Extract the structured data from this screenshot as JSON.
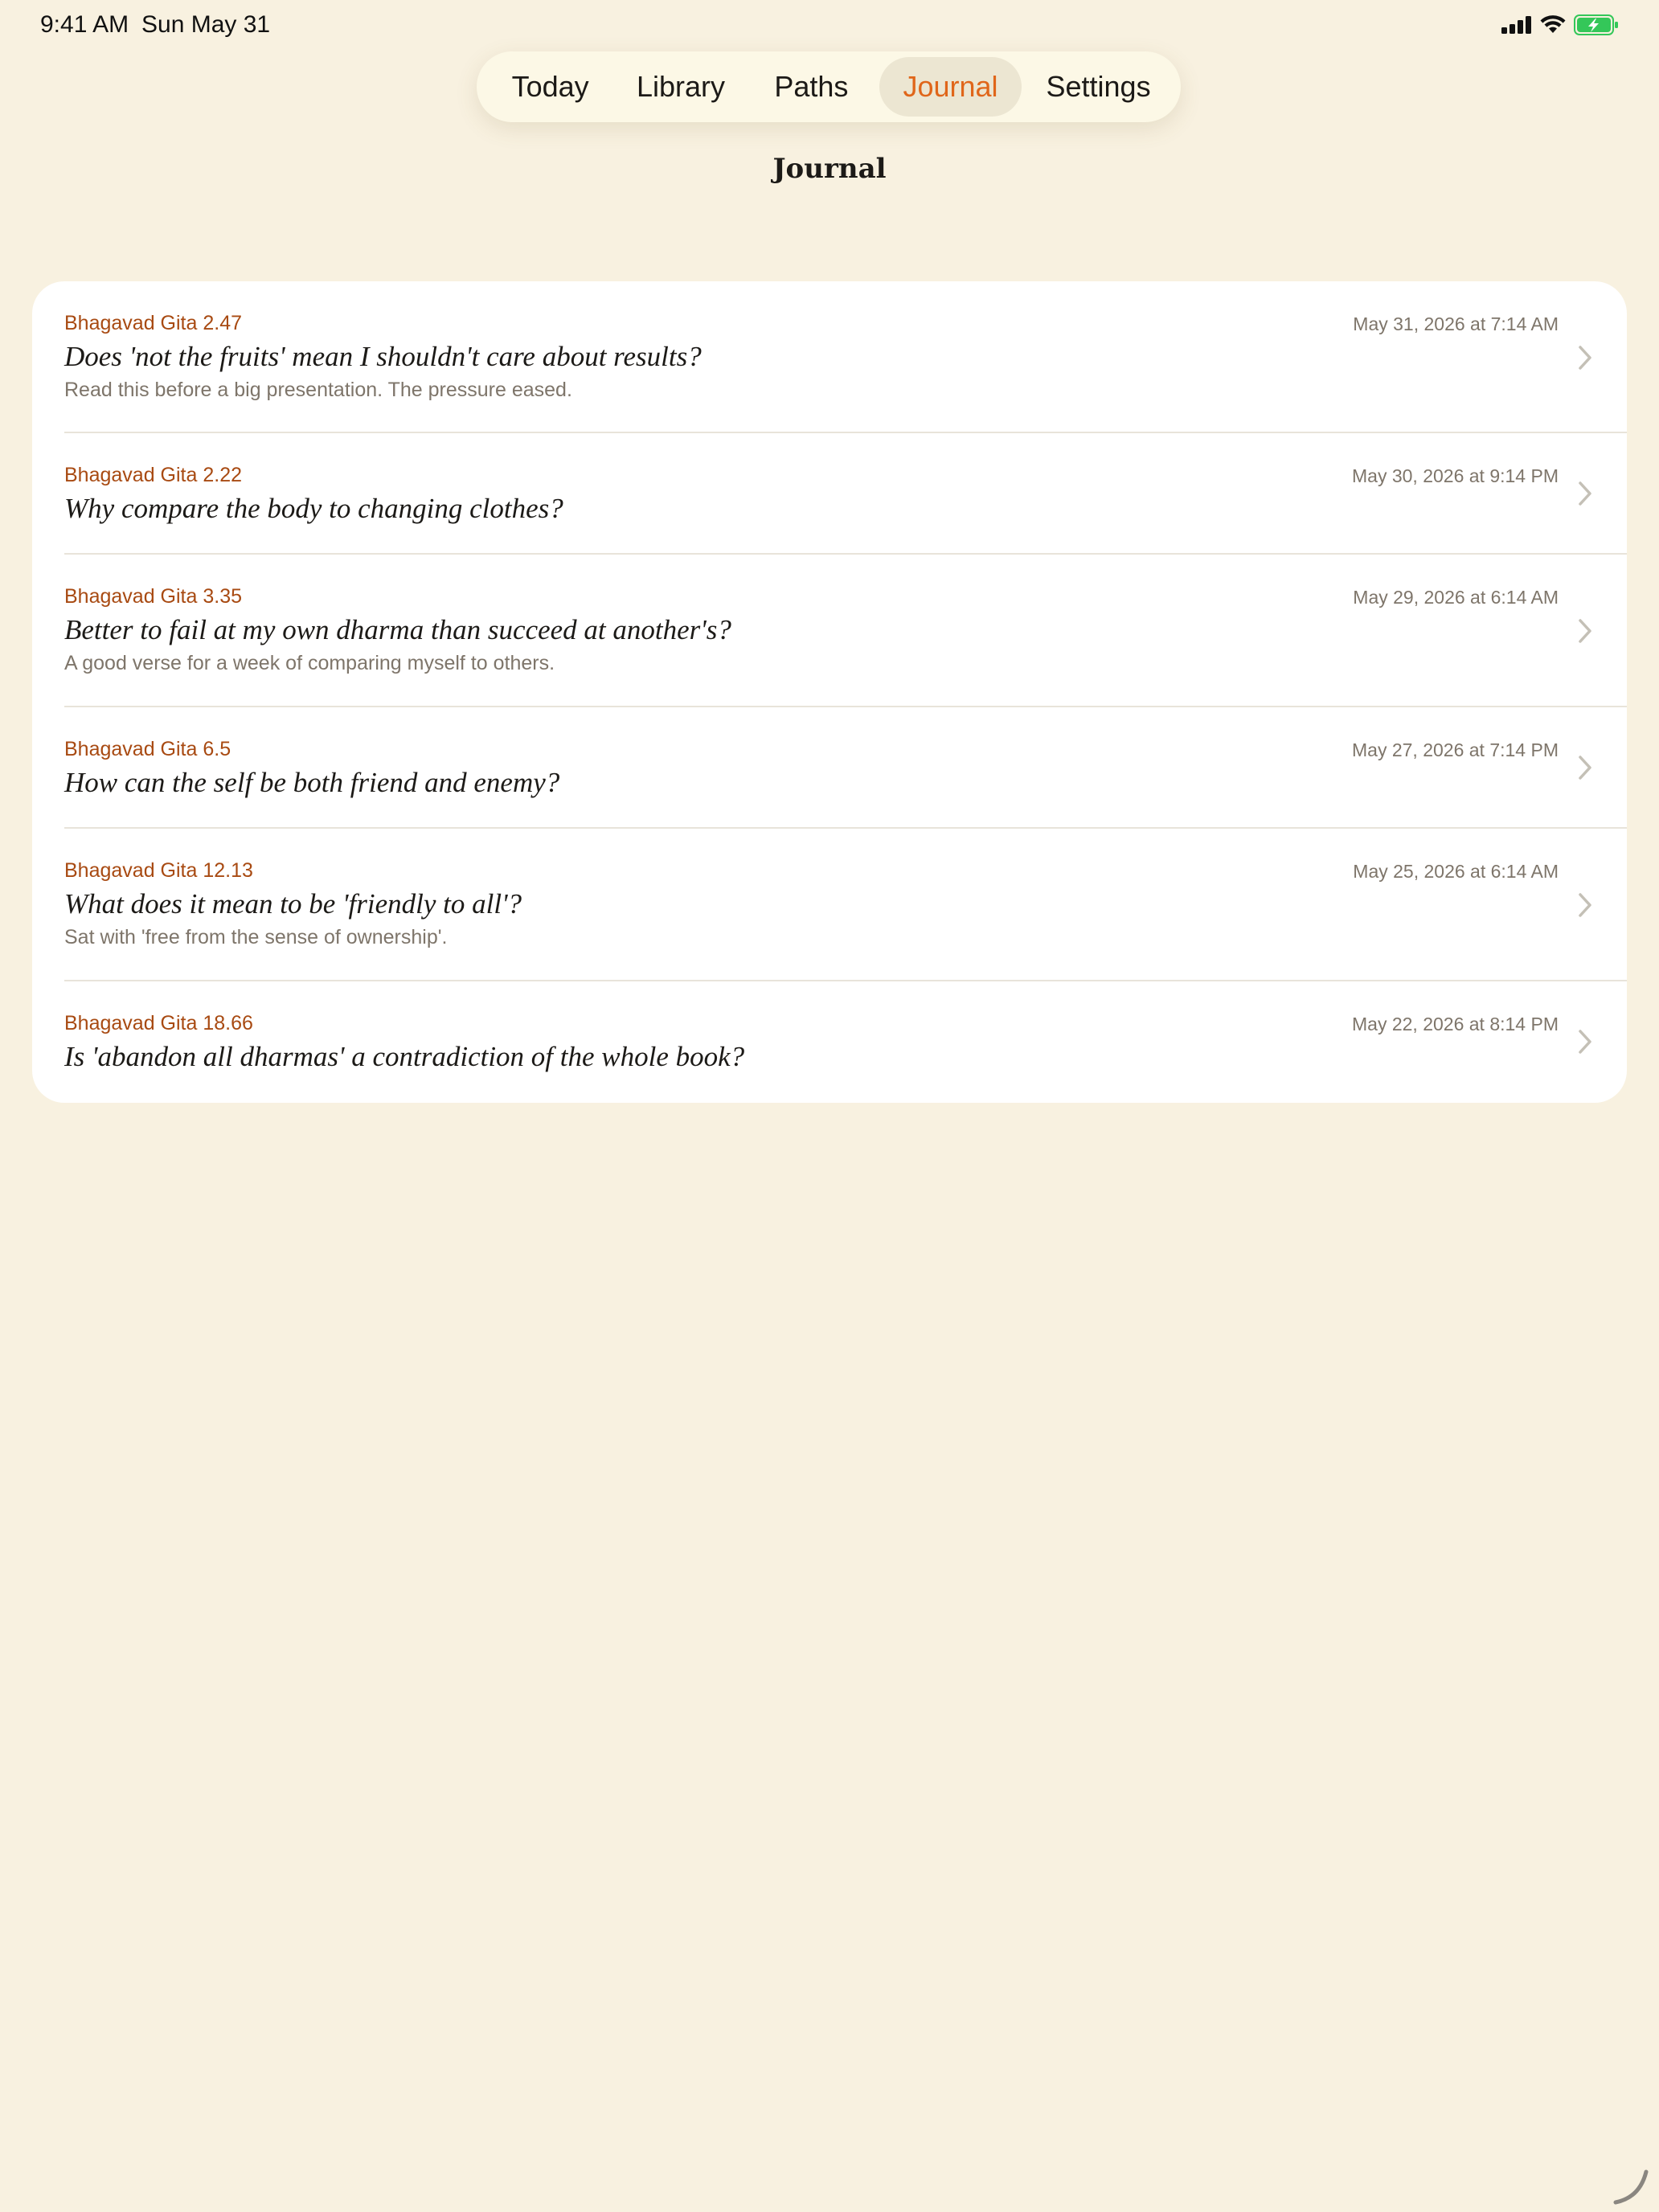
{
  "status_bar": {
    "time": "9:41 AM",
    "date": "Sun May 31",
    "icons": [
      "cellular-signal-icon",
      "wifi-icon",
      "battery-charging-icon"
    ],
    "battery_color": "#34c759"
  },
  "tabs": [
    {
      "label": "Today",
      "active": false
    },
    {
      "label": "Library",
      "active": false
    },
    {
      "label": "Paths",
      "active": false
    },
    {
      "label": "Journal",
      "active": true
    },
    {
      "label": "Settings",
      "active": false
    }
  ],
  "colors": {
    "background": "#f8f1e0",
    "accent": "#e0661a",
    "reference": "#a84a12",
    "secondary_text": "#7e756a"
  },
  "page_title": "Journal",
  "entries": [
    {
      "reference": "Bhagavad Gita 2.47",
      "date": "May 31, 2026 at 7:14 AM",
      "question": "Does 'not the fruits' mean I shouldn't care about results?",
      "note": "Read this before a big presentation. The pressure eased."
    },
    {
      "reference": "Bhagavad Gita 2.22",
      "date": "May 30, 2026 at 9:14 PM",
      "question": "Why compare the body to changing clothes?",
      "note": ""
    },
    {
      "reference": "Bhagavad Gita 3.35",
      "date": "May 29, 2026 at 6:14 AM",
      "question": "Better to fail at my own dharma than succeed at another's?",
      "note": "A good verse for a week of comparing myself to others."
    },
    {
      "reference": "Bhagavad Gita 6.5",
      "date": "May 27, 2026 at 7:14 PM",
      "question": "How can the self be both friend and enemy?",
      "note": ""
    },
    {
      "reference": "Bhagavad Gita 12.13",
      "date": "May 25, 2026 at 6:14 AM",
      "question": "What does it mean to be 'friendly to all'?",
      "note": "Sat with 'free from the sense of ownership'."
    },
    {
      "reference": "Bhagavad Gita 18.66",
      "date": "May 22, 2026 at 8:14 PM",
      "question": "Is 'abandon all dharmas' a contradiction of the whole book?",
      "note": ""
    }
  ]
}
